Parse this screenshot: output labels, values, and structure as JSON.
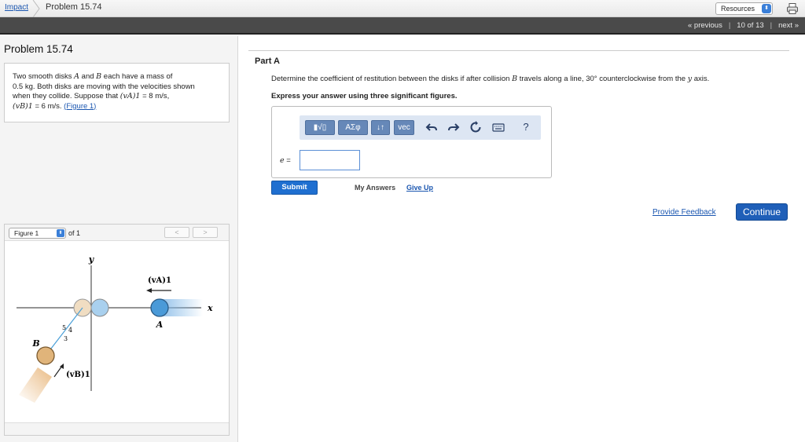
{
  "topbar": {
    "crumb_link": "Impact",
    "title": "Problem 15.74",
    "resources_label": "Resources",
    "print_icon": "printer-icon"
  },
  "nav": {
    "previous": "« previous",
    "position": "10 of 13",
    "next": "next »"
  },
  "problem": {
    "title": "Problem 15.74",
    "text_1": "Two smooth disks",
    "var_a": "A",
    "text_2": "and",
    "var_b": "B",
    "text_3": "each have a mass of",
    "mass": "0.5",
    "mass_unit": "kg",
    "text_4": ". Both disks are moving with the velocities shown",
    "text_5": "when they collide. Suppose that",
    "va_sym": "(vA)1",
    "va_eq": "= 8",
    "va_unit": "m/s",
    "comma": ",",
    "vb_sym": "(vB)1",
    "vb_eq": "= 6",
    "vb_unit": "m/s",
    "period": ".",
    "figure_link": "(Figure 1)"
  },
  "figure": {
    "select_label": "Figure 1",
    "of_label": "of 1",
    "prev_label": "<",
    "next_label": ">",
    "label_y": "y",
    "label_x": "x",
    "label_a": "A",
    "label_b": "B",
    "label_va": "(vA)1",
    "label_vb": "(vB)1",
    "label_5": "5",
    "label_4": "4",
    "label_3": "3"
  },
  "part": {
    "label": "Part A",
    "question_1": "Determine the coefficient of restitution between the disks if after collision",
    "question_var": "B",
    "question_2": "travels along a line, 30° counterclockwise from the",
    "question_axis": "y",
    "question_3": "axis.",
    "instruction": "Express your answer using three significant figures.",
    "toolbar": {
      "templates_label": "▮√▯",
      "symbols_label": "ΑΣφ",
      "sort_label": "↓↑",
      "vec_label": "vec",
      "undo_icon": "undo-icon",
      "redo_icon": "redo-icon",
      "reset_icon": "reset-icon",
      "keyboard_icon": "keyboard-icon",
      "help_label": "?"
    },
    "input_label_var": "e",
    "input_label_eq": "=",
    "input_value": "",
    "submit_label": "Submit",
    "my_answers_label": "My Answers",
    "give_up_label": "Give Up"
  },
  "footer": {
    "feedback_label": "Provide Feedback",
    "continue_label": "Continue"
  }
}
